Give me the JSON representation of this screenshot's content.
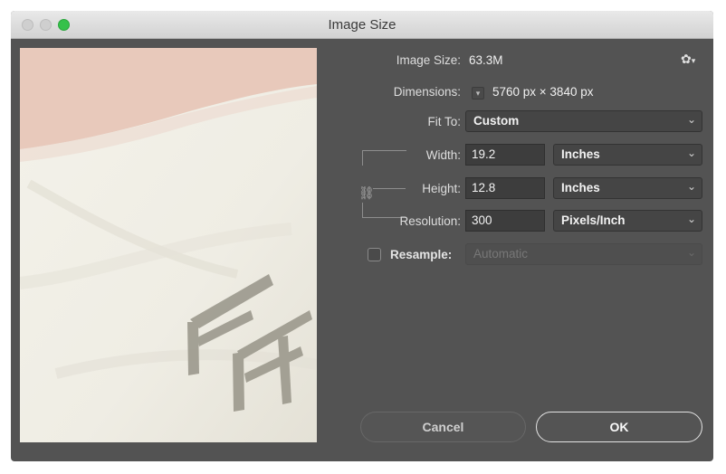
{
  "window": {
    "title": "Image Size"
  },
  "info": {
    "image_size_label": "Image Size:",
    "image_size_value": "63.3M",
    "dimensions_label": "Dimensions:",
    "dimensions_value": "5760 px  ×  3840 px"
  },
  "fit_to": {
    "label": "Fit To:",
    "value": "Custom"
  },
  "width": {
    "label": "Width:",
    "value": "19.2",
    "unit": "Inches"
  },
  "height": {
    "label": "Height:",
    "value": "12.8",
    "unit": "Inches"
  },
  "resolution": {
    "label": "Resolution:",
    "value": "300",
    "unit": "Pixels/Inch"
  },
  "resample": {
    "label": "Resample:",
    "value": "Automatic",
    "checked": false
  },
  "buttons": {
    "cancel": "Cancel",
    "ok": "OK"
  },
  "icons": {
    "gear": "gear-icon",
    "link": "chain-link-icon",
    "chevron": "chevron-down-icon"
  },
  "colors": {
    "panel": "#535353",
    "field": "#3d3d3d",
    "zoom": "#35c14a"
  }
}
